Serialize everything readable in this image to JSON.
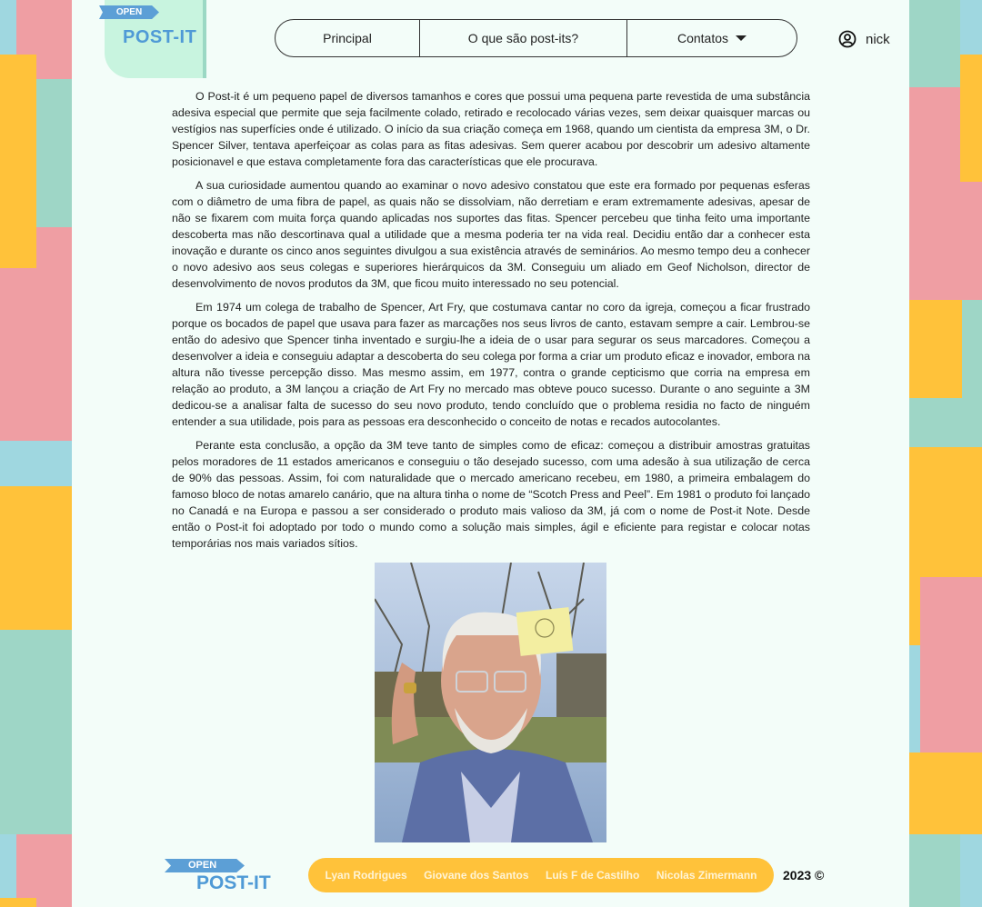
{
  "colors": {
    "yellow": "#ffc23a",
    "pink": "#ef9ea3",
    "teal": "#9ed6c6",
    "cyan": "#9fd7e0",
    "page_bg": "#f3fdf9",
    "brand_blue": "#5c9fd6"
  },
  "header": {
    "logo_tag": "OPEN",
    "logo_text": "POST-IT",
    "nav": [
      {
        "label": "Principal"
      },
      {
        "label": "O que são post-its?"
      },
      {
        "label": "Contatos",
        "icon": "caret-down-icon"
      }
    ],
    "user": {
      "name": "nick",
      "icon": "user-circle-icon"
    }
  },
  "article": {
    "paragraphs": [
      "O Post-it é um pequeno papel de diversos tamanhos e cores que possui uma pequena parte revestida de uma substância adesiva especial que permite que seja facilmente colado, retirado e recolocado várias vezes, sem deixar quaisquer marcas ou vestígios nas superfícies onde é utilizado. O início da sua criação começa em 1968, quando um cientista da empresa 3M, o Dr. Spencer Silver, tentava aperfeiçoar as colas para as fitas adesivas. Sem querer acabou por descobrir um adesivo altamente posicionavel e que estava completamente fora das características que ele procurava.",
      "A sua curiosidade aumentou quando ao examinar o novo adesivo constatou que este era formado por pequenas esferas com o diâmetro de uma fibra de papel, as quais não se dissolviam, não derretiam e eram extremamente adesivas, apesar de não se fixarem com muita força quando aplicadas nos suportes das fitas. Spencer percebeu que tinha feito uma importante descoberta mas não descortinava qual a utilidade que a mesma poderia ter na vida real. Decidiu então dar a conhecer esta inovação e durante os cinco anos seguintes divulgou a sua existência através de seminários. Ao mesmo tempo deu a conhecer o novo adesivo aos seus colegas e superiores hierárquicos da 3M. Conseguiu um aliado em Geof Nicholson, director de desenvolvimento de novos produtos da 3M, que ficou muito interessado no seu potencial.",
      "Em 1974 um colega de trabalho de Spencer, Art Fry, que costumava cantar no coro da igreja, começou a ficar frustrado porque os bocados de papel que usava para fazer as marcações nos seus livros de canto, estavam sempre a cair. Lembrou-se então do adesivo que Spencer tinha inventado e surgiu-lhe a ideia de o usar para segurar os seus marcadores. Começou a desenvolver a ideia e conseguiu adaptar a descoberta do seu colega por forma a criar um produto eficaz e inovador, embora na altura não tivesse percepção disso. Mas mesmo assim, em 1977, contra o grande cepticismo que corria na empresa em relação ao produto, a 3M lançou a criação de Art Fry no mercado mas obteve pouco sucesso. Durante o ano seguinte a 3M dedicou-se a analisar falta de sucesso do seu novo produto, tendo concluído que o problema residia no facto de ninguém entender a sua utilidade, pois para as pessoas era desconhecido o conceito de notas e recados autocolantes.",
      "Perante esta conclusão, a opção da 3M teve tanto de simples como de eficaz: começou a distribuir amostras gratuitas pelos moradores de 11 estados americanos e conseguiu o tão desejado sucesso, com uma adesão à sua utilização de cerca de 90% das pessoas. Assim, foi com naturalidade que o mercado americano recebeu, em 1980, a primeira embalagem do famoso bloco de notas amarelo canário, que na altura tinha o nome de “Scotch Press and Peel”. Em 1981 o produto foi lançado no Canadá e na Europa e passou a ser considerado o produto mais valioso da 3M, já com o nome de Post-it Note. Desde então o Post-it foi adoptado por todo o mundo como a solução mais simples, ágil e eficiente para registar e colocar notas temporárias nos mais variados sítios."
    ]
  },
  "footer": {
    "logo_tag": "OPEN",
    "logo_text": "POST-IT",
    "credits": [
      "Lyan Rodrigues",
      "Giovane dos Santos",
      "Luís F de Castilho",
      "Nicolas Zimermann"
    ],
    "copyright": "2023 ©"
  }
}
